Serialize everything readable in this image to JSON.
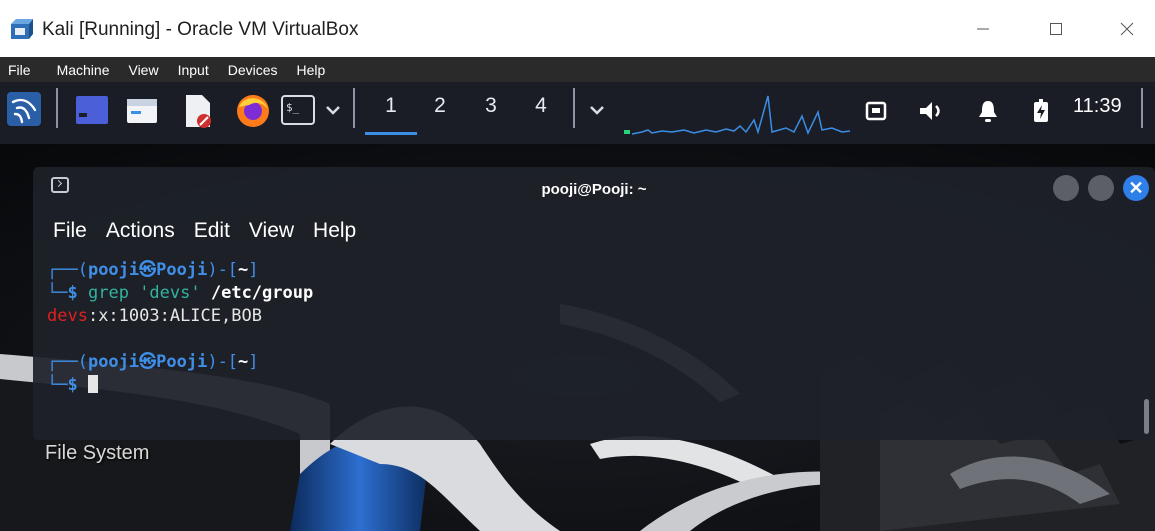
{
  "host_window": {
    "title": "Kali [Running] - Oracle VM VirtualBox",
    "icon": "virtualbox-icon",
    "controls": [
      "minimize-icon",
      "maximize-icon",
      "close-icon"
    ]
  },
  "vbox_menu": {
    "items": [
      "File",
      "Machine",
      "View",
      "Input",
      "Devices",
      "Help"
    ]
  },
  "kali_panel": {
    "launchers": [
      "kali-menu-icon",
      "desktop-icon",
      "file-manager-icon",
      "text-editor-icon",
      "firefox-icon",
      "terminal-icon",
      "chevron-down-icon"
    ],
    "workspaces": [
      "1",
      "2",
      "3",
      "4"
    ],
    "active_workspace": "1",
    "tray": [
      "network-icon",
      "volume-icon",
      "notifications-icon",
      "battery-icon"
    ],
    "clock": "11:39"
  },
  "terminal": {
    "title": "pooji@Pooji: ~",
    "menu": [
      "File",
      "Actions",
      "Edit",
      "View",
      "Help"
    ],
    "prompt_user": "pooji",
    "prompt_host": "Pooji",
    "prompt_dir": "~",
    "command_cmd": "grep",
    "command_arg": "'devs'",
    "command_path": "/etc/group",
    "output_group": "devs",
    "output_rest": ":x:1003:ALICE,BOB",
    "dollar": "$"
  },
  "desktop": {
    "icon_label": "File System"
  },
  "colors": {
    "prompt_blue": "#3f8fe8",
    "string_green": "#33b3a0",
    "match_red": "#e02020",
    "panel_bg": "#1b1d26",
    "accent": "#2f7fe8"
  }
}
